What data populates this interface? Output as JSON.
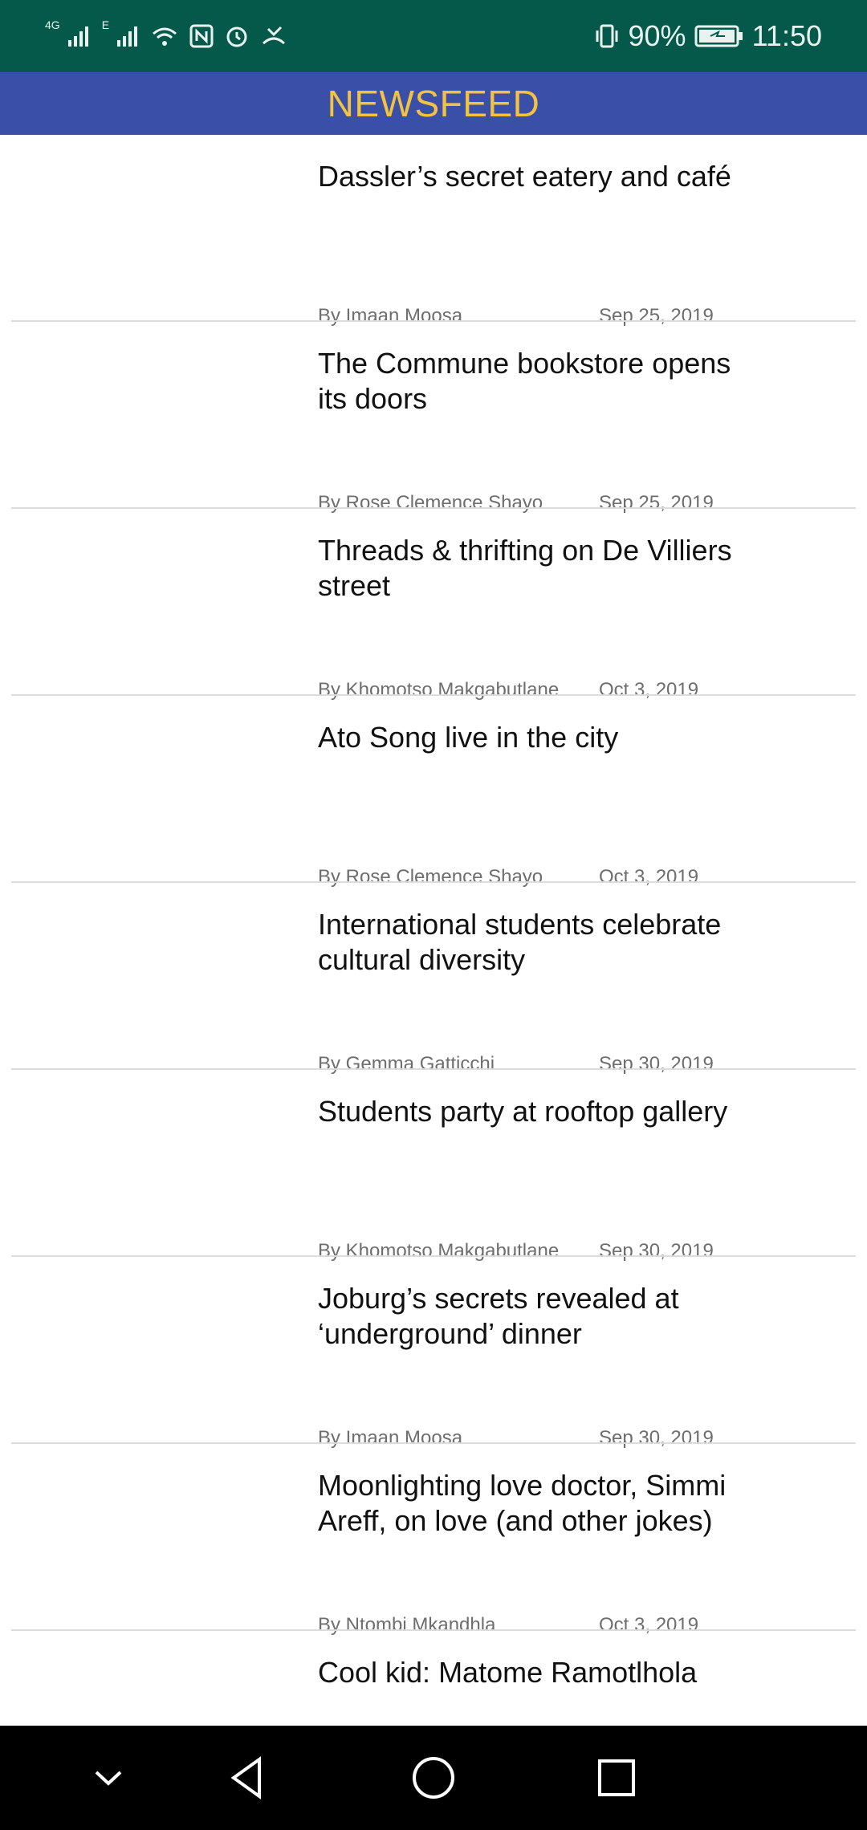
{
  "status_bar": {
    "net1": "4G",
    "net2": "E",
    "battery_percent": "90%",
    "time": "11:50",
    "icons": [
      "signal-icon",
      "signal-icon",
      "wifi-icon",
      "nfc-icon",
      "alarm-icon",
      "missed-call-icon",
      "vibrate-icon",
      "battery-charging-icon"
    ]
  },
  "header": {
    "title": "NEWSFEED"
  },
  "articles": [
    {
      "title": "Dassler’s secret eatery and café",
      "author": "By Imaan Moosa",
      "date": "Sep 25, 2019"
    },
    {
      "title": "The Commune bookstore opens its doors",
      "author": "By Rose Clemence Shayo",
      "date": "Sep 25, 2019"
    },
    {
      "title": "Threads & thrifting on De Villiers street",
      "author": "By Khomotso Makgabutlane",
      "date": "Oct 3, 2019"
    },
    {
      "title": "Ato Song live in the city",
      "author": "By Rose Clemence Shayo",
      "date": "Oct 3, 2019"
    },
    {
      "title": "International students celebrate cultural diversity",
      "author": "By Gemma Gatticchi",
      "date": "Sep 30, 2019"
    },
    {
      "title": "Students party at rooftop gallery",
      "author": "By Khomotso Makgabutlane",
      "date": "Sep 30, 2019"
    },
    {
      "title": "Joburg’s secrets revealed at ‘underground’ dinner",
      "author": "By Imaan Moosa",
      "date": "Sep 30, 2019"
    },
    {
      "title": "Moonlighting love doctor, Simmi Areff, on love (and other jokes)",
      "author": "By Ntombi Mkandhla",
      "date": "Oct 3, 2019"
    },
    {
      "title": "Cool kid: Matome Ramotlhola",
      "author": "",
      "date": ""
    }
  ],
  "nav_bar": {
    "icons": [
      "chevron-down-icon",
      "back-icon",
      "home-icon",
      "recents-icon"
    ]
  },
  "colors": {
    "status_bar": "#04594a",
    "app_bar": "#3a50a8",
    "title_text": "#f2c240"
  }
}
